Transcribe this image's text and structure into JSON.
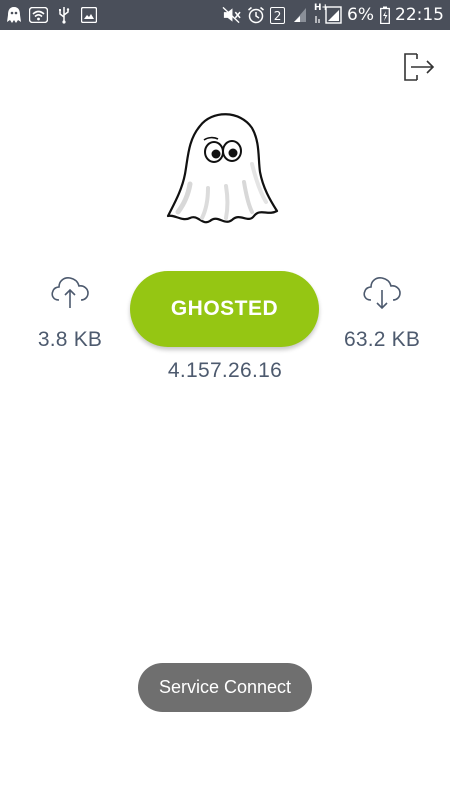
{
  "status_bar": {
    "left_icons": [
      "ghost-icon",
      "wifi-icon",
      "usb-icon",
      "image-icon"
    ],
    "right_icons": [
      "mute-icon",
      "alarm-icon",
      "sim-badge-icon",
      "signal-icon",
      "hplus-signal-icon",
      "battery-icon"
    ],
    "sim_badge": "2",
    "network_type": "H+",
    "battery": "6%",
    "time": "22:15"
  },
  "header": {
    "logout_icon": "logout-icon"
  },
  "main": {
    "ghost_image": "ghost-icon",
    "upload": {
      "icon": "cloud-upload-icon",
      "value": "3.8 KB"
    },
    "download": {
      "icon": "cloud-download-icon",
      "value": "63.2 KB"
    },
    "status_button": "GHOSTED",
    "ip_address": "4.157.26.16"
  },
  "toast": {
    "text": "Service Connect"
  },
  "colors": {
    "status_bar": "#4a4f5a",
    "accent_green": "#95c613",
    "text_gray_blue": "#4d5a6e",
    "toast_bg": "#6f6f6f"
  }
}
